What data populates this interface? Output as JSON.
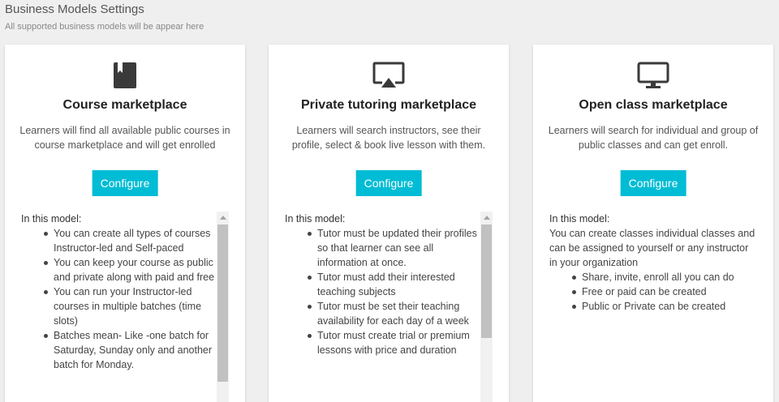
{
  "header": {
    "title": "Business Models Settings",
    "subtitle": "All supported business models will be appear here"
  },
  "cards": [
    {
      "icon": "book-icon",
      "title": "Course marketplace",
      "description": "Learners will find all available public courses in course marketplace and will get enrolled",
      "button_label": "Configure",
      "model_heading": "In this model:",
      "items": [
        "You can create all types of courses Instructor-led and Self-paced",
        "You can keep your course as public and private along with paid and free",
        "You can run your Instructor-led courses in multiple batches (time slots)",
        "Batches mean- Like -one batch for Saturday, Sunday only and another batch for Monday."
      ]
    },
    {
      "icon": "airplay-icon",
      "title": "Private tutoring marketplace",
      "description": "Learners will search instructors, see their profile, select & book live lesson with them.",
      "button_label": "Configure",
      "model_heading": "In this model:",
      "items": [
        "Tutor must be updated their profiles so that learner can see all information at once.",
        "Tutor must add their interested teaching subjects",
        "Tutor must be set their teaching availability for each day of a week",
        "Tutor must create trial or premium lessons with price and duration"
      ]
    },
    {
      "icon": "monitor-icon",
      "title": "Open class marketplace",
      "description": "Learners will search for individual and group of public classes and can get enroll.",
      "button_label": "Configure",
      "model_heading": "In this model:",
      "model_text": "You can create classes individual classes and can be assigned to yourself or any instructor in your organization",
      "items": [
        "Share, invite, enroll all you can do",
        "Free or paid can be created",
        "Public or Private can be created"
      ]
    }
  ]
}
